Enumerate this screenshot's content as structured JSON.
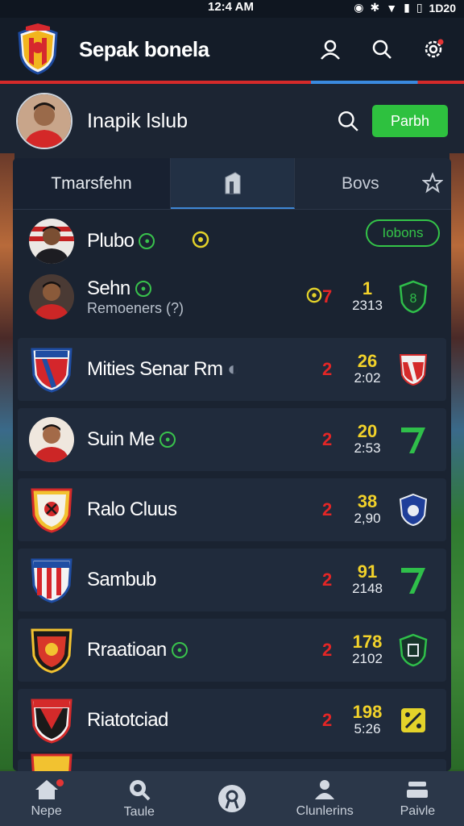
{
  "status": {
    "time": "12:4 AM",
    "battery": "1D20"
  },
  "app": {
    "title": "Sepak bonela"
  },
  "profile": {
    "club": "Inapik lslub",
    "button": "Parbh"
  },
  "tabs": [
    {
      "label": "Tmarsfehn"
    },
    {
      "label": ""
    },
    {
      "label": "Bovs"
    }
  ],
  "first": {
    "pill": "Iobons",
    "row1": {
      "name": "Plubo"
    },
    "row2": {
      "name": "Sehn",
      "sub": "Remoeners (?)",
      "r": "7",
      "stat_top": "1",
      "stat_bot": "2313"
    }
  },
  "clubs": [
    {
      "name": "Mities Senar Rm",
      "r": "2",
      "stat_top": "26",
      "stat_bot": "2:02"
    },
    {
      "name": "Suin Me",
      "r": "2",
      "stat_top": "20",
      "stat_bot": "2:53"
    },
    {
      "name": "Ralo Cluus",
      "r": "2",
      "stat_top": "38",
      "stat_bot": "2,90"
    },
    {
      "name": "Sambub",
      "r": "2",
      "stat_top": "91",
      "stat_bot": "2148"
    },
    {
      "name": "Rraatioan",
      "r": "2",
      "stat_top": "178",
      "stat_bot": "2102"
    },
    {
      "name": "Riatotciad",
      "r": "2",
      "stat_top": "198",
      "stat_bot": "5:26"
    }
  ],
  "nav": [
    {
      "label": "Nepe"
    },
    {
      "label": "Taule"
    },
    {
      "label": ""
    },
    {
      "label": "Clunlerins"
    },
    {
      "label": "Paivle"
    }
  ],
  "colors": {
    "accent_green": "#2ec13f",
    "accent_red": "#e42626",
    "stat_yellow": "#f2d22a"
  }
}
